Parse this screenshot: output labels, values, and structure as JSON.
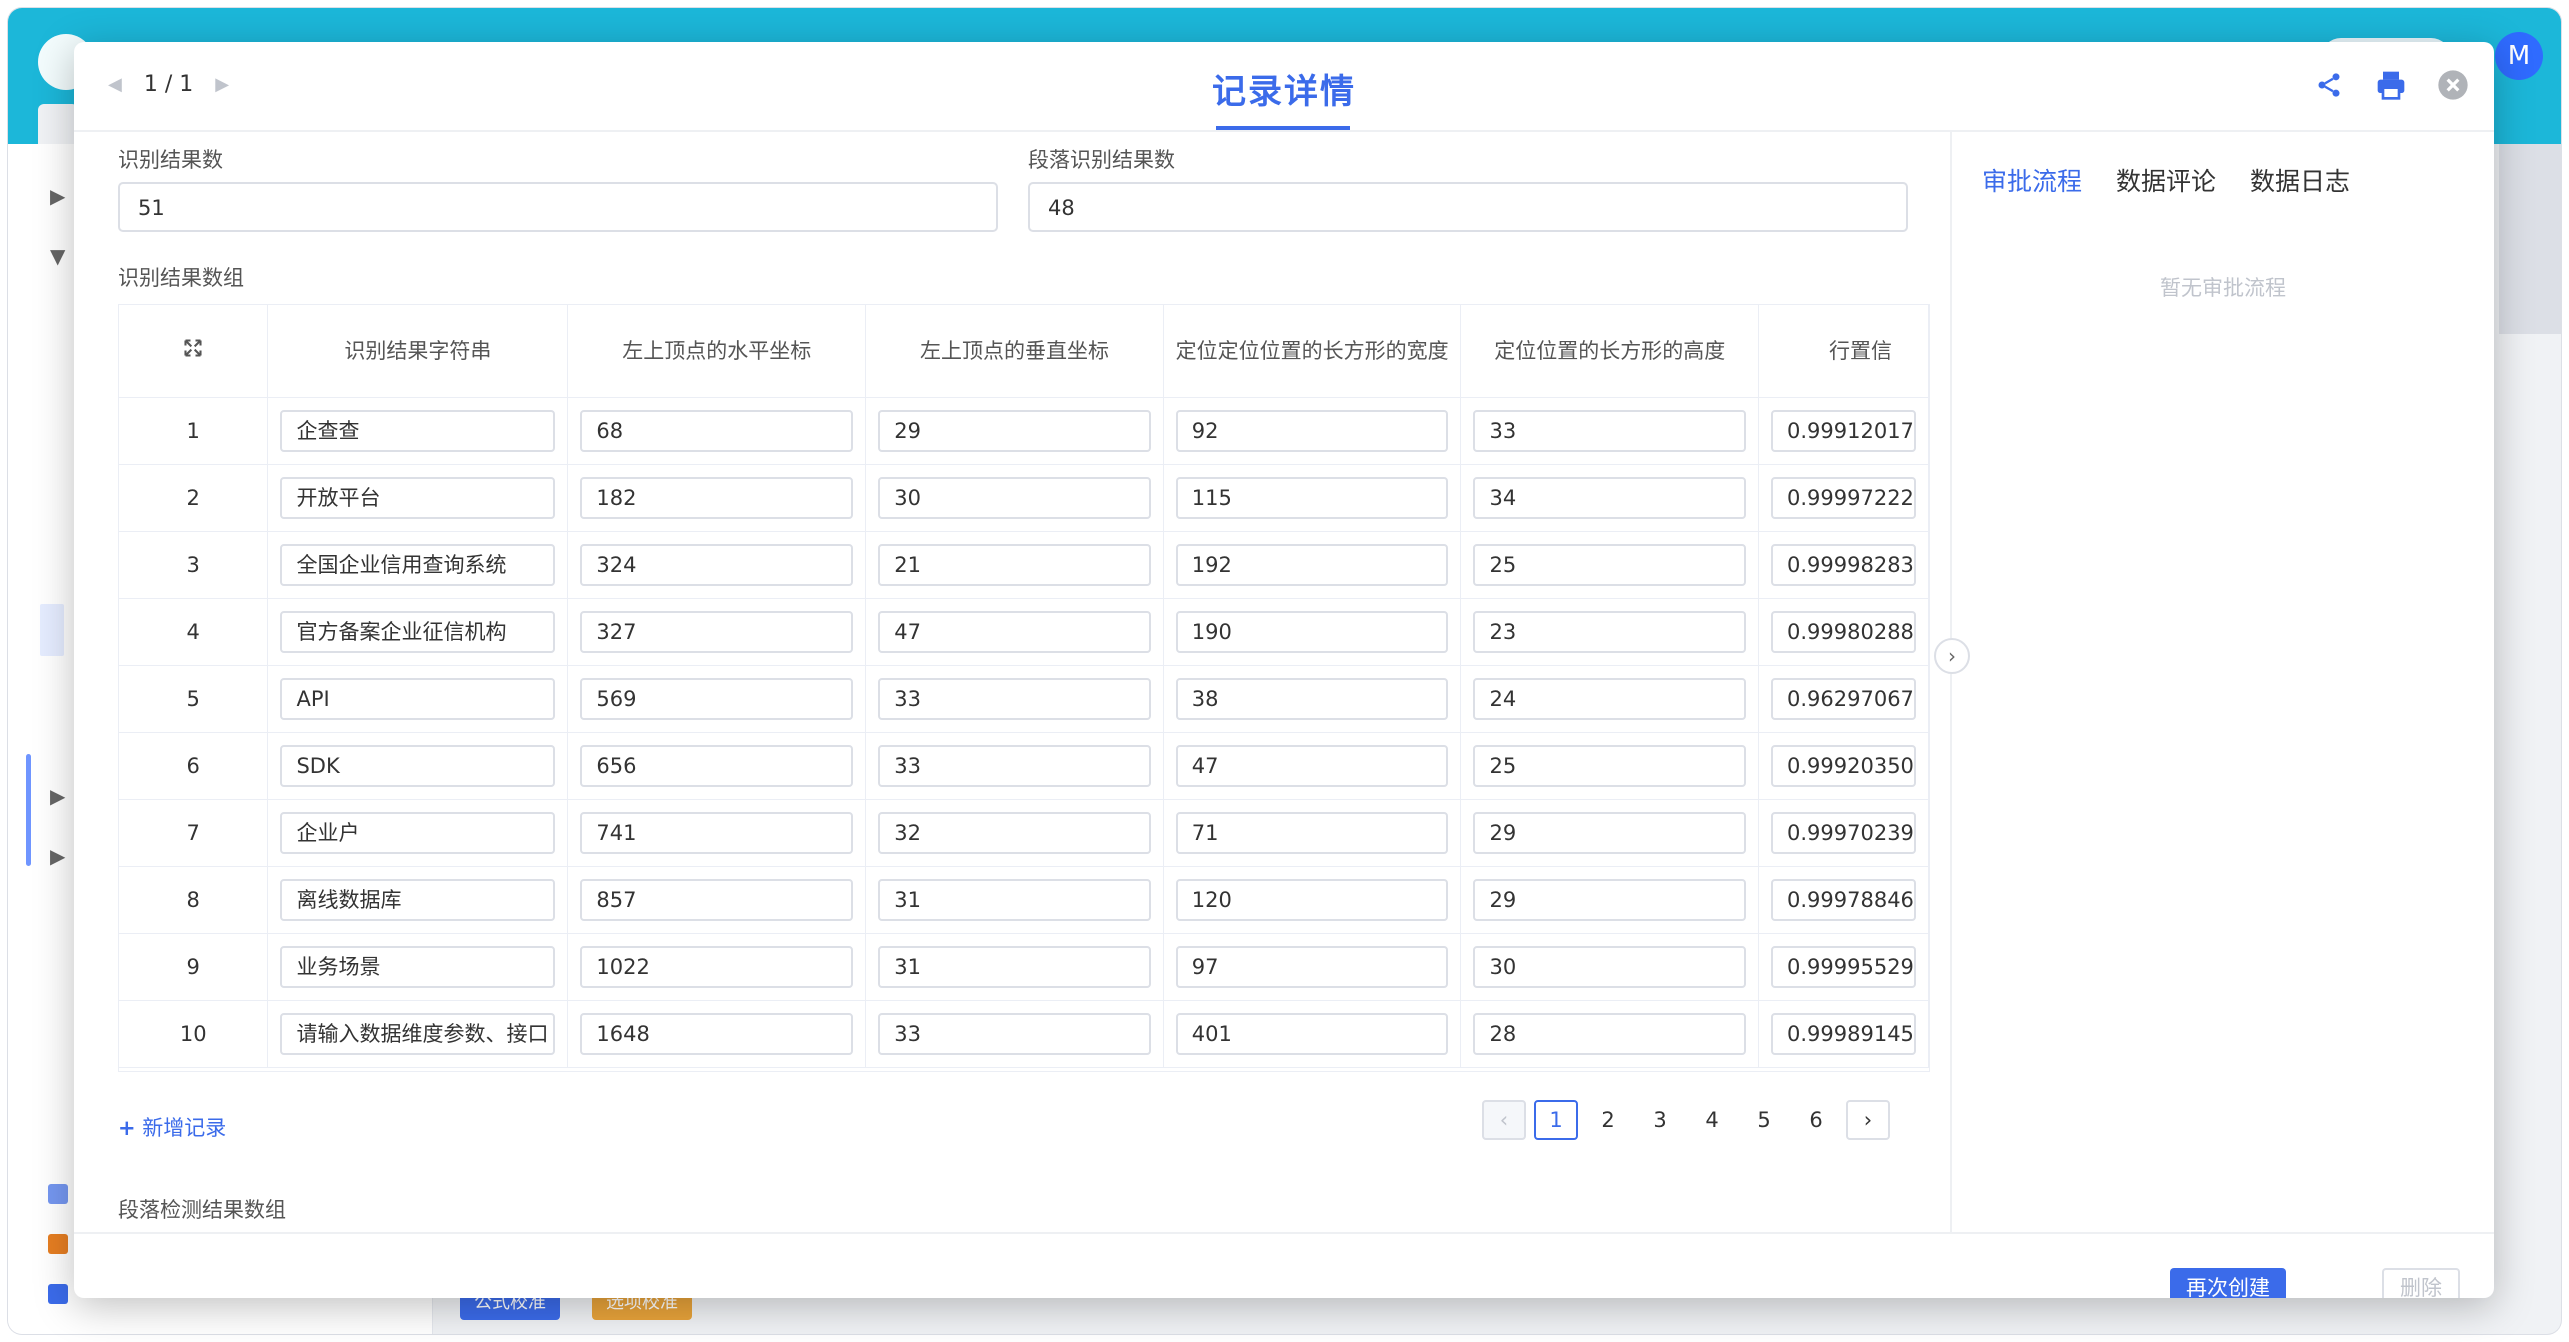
{
  "modal": {
    "title": "记录详情",
    "pager_text": "1 / 1"
  },
  "fields": {
    "result_count_label": "识别结果数",
    "result_count_value": "51",
    "paragraph_count_label": "段落识别结果数",
    "paragraph_count_value": "48",
    "array_label": "识别结果数组",
    "paragraph_array_label": "段落检测结果数组"
  },
  "table": {
    "columns": [
      "识别结果字符串",
      "左上顶点的水平坐标",
      "左上顶点的垂直坐标",
      "定位定位位置的长方形的宽度",
      "定位位置的长方形的高度",
      "行置信"
    ],
    "rows": [
      [
        "1",
        "企查查",
        "68",
        "29",
        "92",
        "33",
        "0.99912017"
      ],
      [
        "2",
        "开放平台",
        "182",
        "30",
        "115",
        "34",
        "0.99997222"
      ],
      [
        "3",
        "全国企业信用查询系统",
        "324",
        "21",
        "192",
        "25",
        "0.99998283"
      ],
      [
        "4",
        "官方备案企业征信机构",
        "327",
        "47",
        "190",
        "23",
        "0.99980288"
      ],
      [
        "5",
        "API",
        "569",
        "33",
        "38",
        "24",
        "0.96297067"
      ],
      [
        "6",
        "SDK",
        "656",
        "33",
        "47",
        "25",
        "0.99920350"
      ],
      [
        "7",
        "企业户",
        "741",
        "32",
        "71",
        "29",
        "0.99970239"
      ],
      [
        "8",
        "离线数据库",
        "857",
        "31",
        "120",
        "29",
        "0.99978846"
      ],
      [
        "9",
        "业务场景",
        "1022",
        "31",
        "97",
        "30",
        "0.99995529"
      ],
      [
        "10",
        "请输入数据维度参数、接口",
        "1648",
        "33",
        "401",
        "28",
        "0.99989145"
      ]
    ]
  },
  "add_record": "新增记录",
  "pagination": [
    "1",
    "2",
    "3",
    "4",
    "5",
    "6"
  ],
  "side_panel": {
    "tabs": [
      "审批流程",
      "数据评论",
      "数据日志"
    ],
    "empty": "暂无审批流程"
  },
  "footer": {
    "recreate": "再次创建",
    "delete": "删除"
  },
  "background": {
    "avatar": "M",
    "btn1": "公式校准",
    "btn2": "选项校准"
  },
  "colors": {
    "accent": "#3b6bea",
    "header": "#1cb7d9"
  }
}
